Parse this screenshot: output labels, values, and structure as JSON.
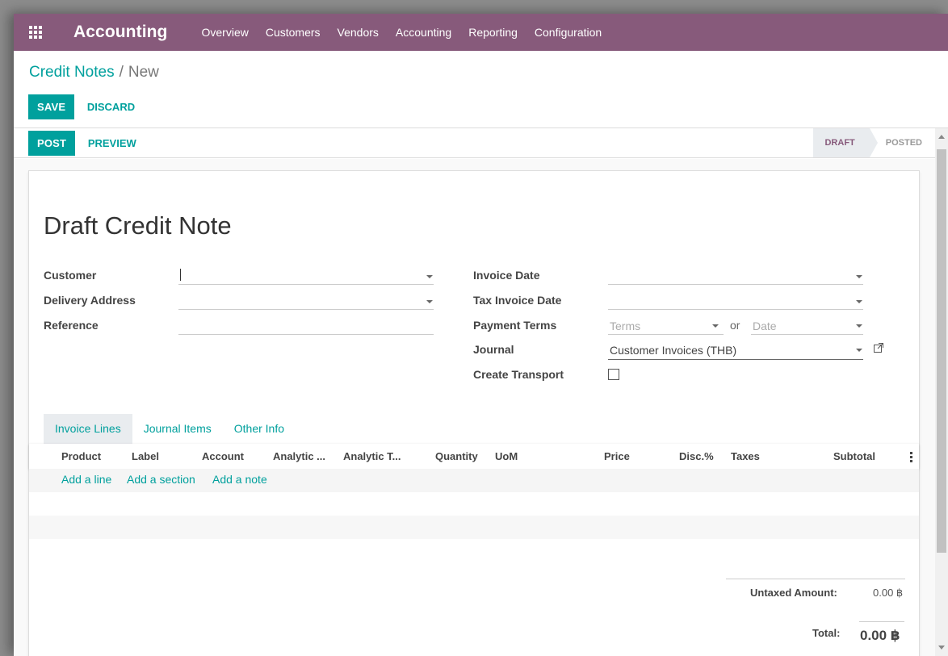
{
  "nav": {
    "app_name": "Accounting",
    "menu": [
      "Overview",
      "Customers",
      "Vendors",
      "Accounting",
      "Reporting",
      "Configuration"
    ],
    "bg_color": "#875a7b"
  },
  "breadcrumb": {
    "parent": "Credit Notes",
    "separator": "/",
    "current": "New"
  },
  "control": {
    "save_label": "SAVE",
    "discard_label": "DISCARD"
  },
  "statusbar": {
    "post_label": "POST",
    "preview_label": "PREVIEW",
    "stages": [
      "DRAFT",
      "POSTED"
    ],
    "active_stage": "DRAFT"
  },
  "form": {
    "title": "Draft Credit Note",
    "left": {
      "customer_label": "Customer",
      "delivery_label": "Delivery Address",
      "reference_label": "Reference"
    },
    "right": {
      "invoice_date_label": "Invoice Date",
      "tax_invoice_date_label": "Tax Invoice Date",
      "payment_terms_label": "Payment Terms",
      "terms_placeholder": "Terms",
      "or_text": "or",
      "date_placeholder": "Date",
      "journal_label": "Journal",
      "journal_value": "Customer Invoices (THB)",
      "create_transport_label": "Create Transport"
    }
  },
  "tabs": [
    "Invoice Lines",
    "Journal Items",
    "Other Info"
  ],
  "lines": {
    "columns": [
      "Product",
      "Label",
      "Account",
      "Analytic ...",
      "Analytic T...",
      "Quantity",
      "UoM",
      "Price",
      "Disc.%",
      "Taxes",
      "Subtotal"
    ],
    "add_line": "Add a line",
    "add_section": "Add a section",
    "add_note": "Add a note"
  },
  "totals": {
    "untaxed_label": "Untaxed Amount:",
    "untaxed_value": "0.00 ฿",
    "total_label": "Total:",
    "total_value": "0.00 ฿"
  },
  "icons": {
    "apps": "apps-grid-icon",
    "external": "external-link-icon",
    "dropdown": "caret-down-icon"
  },
  "colors": {
    "accent": "#00a09d",
    "brand": "#875a7b"
  }
}
